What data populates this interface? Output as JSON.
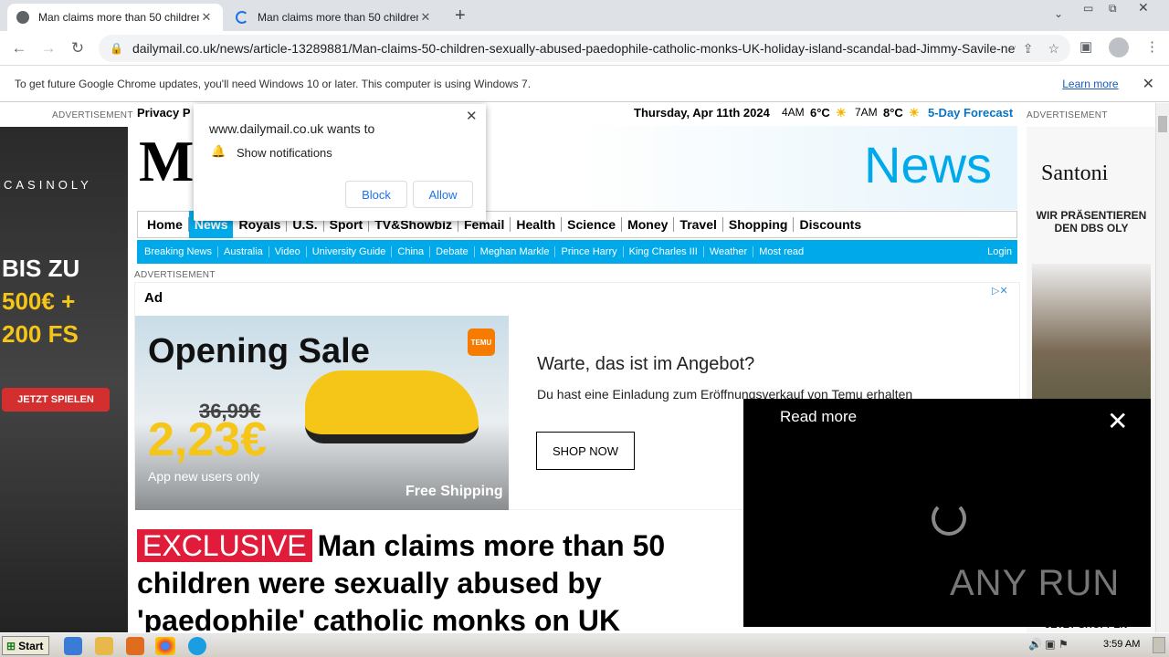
{
  "browser": {
    "tabs": [
      {
        "title": "Man claims more than 50 children we"
      },
      {
        "title": "Man claims more than 50 children we"
      }
    ],
    "new_tab": "+",
    "url": "dailymail.co.uk/news/article-13289881/Man-claims-50-children-sexually-abused-paedophile-catholic-monks-UK-holiday-island-scandal-bad-Jimmy-Savile-new..."
  },
  "infobar": {
    "message": "To get future Google Chrome updates, you'll need Windows 10 or later. This computer is using Windows 7.",
    "link": "Learn more"
  },
  "site": {
    "advertisement": "ADVERTISEMENT",
    "privacy": "Privacy P",
    "date": "Thursday, Apr 11th 2024",
    "weather": [
      {
        "time": "4AM",
        "temp": "6°C"
      },
      {
        "time": "7AM",
        "temp": "8°C"
      }
    ],
    "forecast": "5-Day Forecast",
    "logo": "M",
    "section": "News",
    "nav": [
      "Home",
      "News",
      "Royals",
      "U.S.",
      "Sport",
      "TV&Showbiz",
      "Femail",
      "Health",
      "Science",
      "Money",
      "Travel",
      "Shopping",
      "Discounts"
    ],
    "subnav": [
      "Breaking News",
      "Australia",
      "Video",
      "University Guide",
      "China",
      "Debate",
      "Meghan Markle",
      "Prince Harry",
      "King Charles III",
      "Weather",
      "Most read"
    ],
    "login": "Login"
  },
  "ad": {
    "label": "Ad",
    "sale_title": "Opening Sale",
    "old_price": "36,99€",
    "new_price": "2,23€",
    "app_note": "App new users only",
    "free_ship": "Free Shipping",
    "brand": "TEMU",
    "heading": "Warte, das ist im Angebot?",
    "body": "Du hast eine Einladung zum Eröffnungsverkauf von Temu erhalten",
    "cta": "SHOP NOW"
  },
  "left_ad": {
    "brand": "CASINOLY",
    "line1": "BIS ZU",
    "line2": "500€ +",
    "line3": "200 FS",
    "cta": "JETZT SPIELEN"
  },
  "right_ad": {
    "brand": "Santoni",
    "text": "WIR PRÄSENTIEREN DEN DBS OLY",
    "cta": "JETZT SHOPPEN"
  },
  "article": {
    "tag": "EXCLUSIVE",
    "headline": "Man claims more than 50 children were sexually abused by 'paedophile' catholic monks on UK"
  },
  "notification": {
    "site": "www.dailymail.co.uk wants to",
    "request": "Show notifications",
    "block": "Block",
    "allow": "Allow"
  },
  "video": {
    "title": "Read more",
    "watermark": "ANY RUN"
  },
  "taskbar": {
    "start": "Start",
    "time": "3:59 AM"
  }
}
